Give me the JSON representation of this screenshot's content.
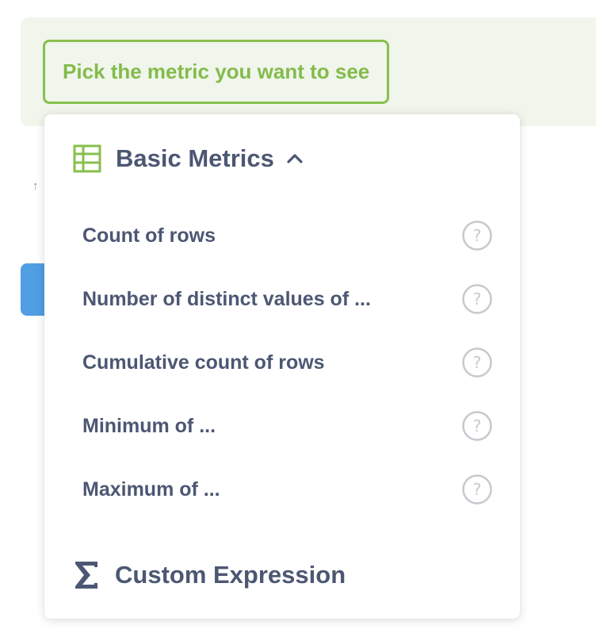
{
  "metric_picker": {
    "button_label": "Pick the metric you want to see"
  },
  "popover": {
    "section": {
      "title": "Basic Metrics",
      "icon": "table-icon",
      "expanded_icon": "chevron-up-icon"
    },
    "metrics": [
      {
        "label": "Count of rows",
        "icon": "help-circle-icon"
      },
      {
        "label": "Number of distinct values of ...",
        "icon": "help-circle-icon"
      },
      {
        "label": "Cumulative count of rows",
        "icon": "help-circle-icon"
      },
      {
        "label": "Minimum of ...",
        "icon": "help-circle-icon"
      },
      {
        "label": "Maximum of ...",
        "icon": "help-circle-icon"
      }
    ],
    "custom": {
      "title": "Custom Expression",
      "icon": "sigma-icon"
    }
  },
  "colors": {
    "brand_green": "#88BF4D",
    "panel_bg": "#F0F6EB",
    "text_dark": "#4C5773",
    "help_gray": "#C6C9CE",
    "brand_blue": "#509EE3"
  }
}
